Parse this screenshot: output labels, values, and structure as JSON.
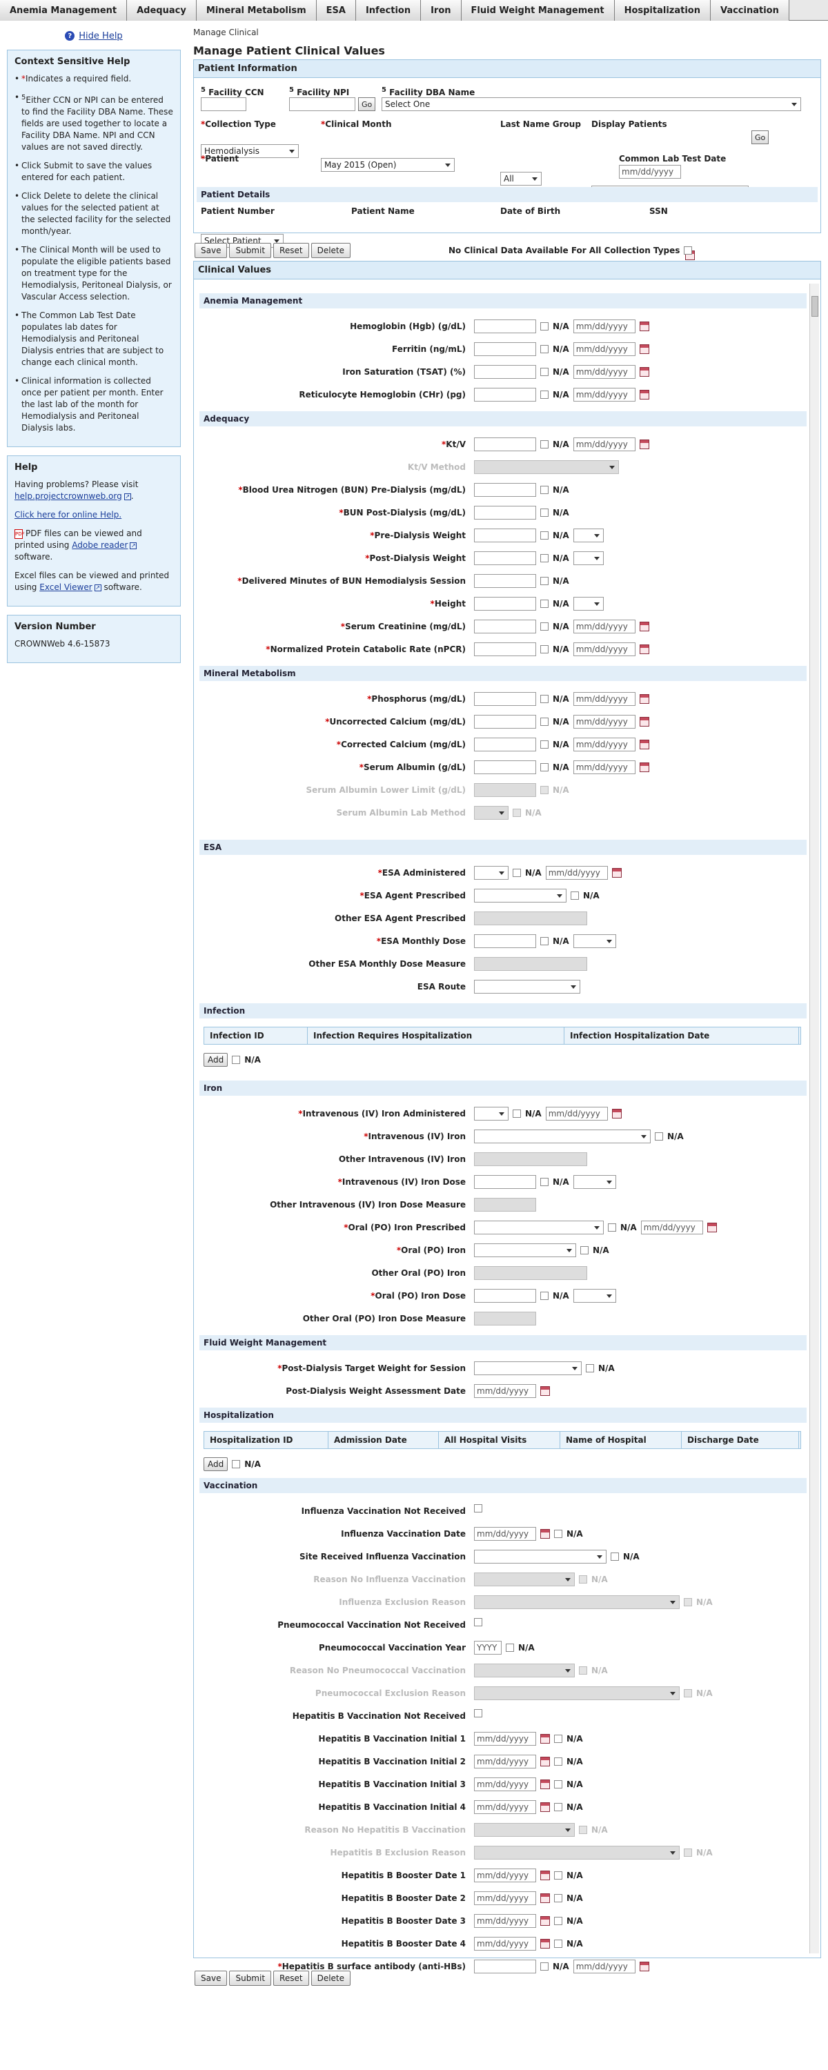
{
  "tabs": [
    "Anemia Management",
    "Adequacy",
    "Mineral Metabolism",
    "ESA",
    "Infection",
    "Iron",
    "Fluid Weight Management",
    "Hospitalization",
    "Vaccination"
  ],
  "help": {
    "hide": "Hide Help",
    "context_title": "Context Sensitive Help",
    "items": [
      "Indicates a required field.",
      "Either CCN or NPI can be entered to find the Facility DBA Name. These fields are used together to locate a Facility DBA Name. NPI and CCN values are not saved directly.",
      "Click Submit to save the values entered for each patient.",
      "Click Delete to delete the clinical values for the selected patient at the selected facility for the selected month/year.",
      "The Clinical Month will be used to populate the eligible patients based on treatment type for the Hemodialysis, Peritoneal Dialysis, or Vascular Access selection.",
      "The Common Lab Test Date populates lab dates for Hemodialysis and Peritoneal Dialysis entries that are subject to change each clinical month.",
      "Clinical information is collected once per patient per month. Enter the last lab of the month for Hemodialysis and Peritoneal Dialysis labs."
    ],
    "help_title": "Help",
    "problems": "Having problems? Please visit",
    "help_link": "help.projectcrownweb.org",
    "online": "Click here for online Help.",
    "pdf_text": "PDF files can be viewed and printed using",
    "pdf_link": "Adobe reader",
    "excel_text": "Excel files can be viewed and printed using",
    "excel_link": "Excel Viewer",
    "software": "software.",
    "version_title": "Version Number",
    "version": "CROWNWeb 4.6-15873"
  },
  "main": {
    "crumb": "Manage Clinical",
    "title": "Manage Patient Clinical Values",
    "patient_info": "Patient Information",
    "fac_ccn": "Facility CCN",
    "fac_npi": "Facility NPI",
    "fac_dba": "Facility DBA Name",
    "dba_value": "Select One",
    "go": "Go",
    "coll_type": "Collection Type",
    "coll_value": "Hemodialysis",
    "month": "Clinical Month",
    "month_value": "May 2015 (Open)",
    "lastname": "Last Name Group",
    "lastname_value": "All",
    "display": "Display Patients",
    "patient": "Patient",
    "patient_value": "Select Patient",
    "common_date": "Common Lab Test Date",
    "date_ph": "mm/dd/yyyy",
    "details": "Patient Details",
    "details_cols": [
      "Patient Number",
      "Patient Name",
      "Date of Birth",
      "SSN"
    ],
    "save": "Save",
    "submit": "Submit",
    "reset": "Reset",
    "delete": "Delete",
    "no_data": "No Clinical Data Available For All Collection Types",
    "clinical": "Clinical Values",
    "na": "N/A",
    "yyyy": "YYYY",
    "add": "Add"
  },
  "sections": {
    "anemia": "Anemia Management",
    "adequacy": "Adequacy",
    "mineral": "Mineral Metabolism",
    "esa": "ESA",
    "infection": "Infection",
    "iron": "Iron",
    "fluid": "Fluid Weight Management",
    "hosp": "Hospitalization",
    "vacc": "Vaccination"
  },
  "labels": {
    "hgb": "Hemoglobin (Hgb) (g/dL)",
    "ferritin": "Ferritin (ng/mL)",
    "tsat": "Iron Saturation (TSAT) (%)",
    "chr": "Reticulocyte Hemoglobin (CHr) (pg)",
    "ktv": "Kt/V",
    "ktv_method": "Kt/V Method",
    "bun_pre": "Blood Urea Nitrogen (BUN) Pre-Dialysis (mg/dL)",
    "bun_post": "BUN Post-Dialysis (mg/dL)",
    "pre_wt": "Pre-Dialysis Weight",
    "post_wt": "Post-Dialysis Weight",
    "delivered": "Delivered Minutes of BUN Hemodialysis Session",
    "height": "Height",
    "creat": "Serum Creatinine (mg/dL)",
    "npcr": "Normalized Protein Catabolic Rate (nPCR)",
    "phos": "Phosphorus (mg/dL)",
    "uncorr": "Uncorrected Calcium (mg/dL)",
    "corr": "Corrected Calcium (mg/dL)",
    "albumin": "Serum Albumin (g/dL)",
    "alb_lower": "Serum Albumin Lower Limit (g/dL)",
    "alb_method": "Serum Albumin Lab Method",
    "esa_admin": "ESA Administered",
    "esa_agent": "ESA Agent Prescribed",
    "esa_other": "Other ESA Agent Prescribed",
    "esa_dose": "ESA Monthly Dose",
    "esa_other_dose": "Other ESA Monthly Dose Measure",
    "esa_route": "ESA Route",
    "inf_cols": [
      "Infection ID",
      "Infection Requires Hospitalization",
      "Infection Hospitalization Date"
    ],
    "iv_admin": "Intravenous (IV) Iron Administered",
    "iv_iron": "Intravenous (IV) Iron",
    "iv_other": "Other Intravenous (IV) Iron",
    "iv_dose": "Intravenous (IV) Iron Dose",
    "iv_other_dose": "Other Intravenous (IV) Iron Dose Measure",
    "po_pres": "Oral (PO) Iron Prescribed",
    "po_iron": "Oral (PO) Iron",
    "po_other": "Other Oral (PO) Iron",
    "po_dose": "Oral (PO) Iron Dose",
    "po_other_dose": "Other Oral (PO) Iron Dose Measure",
    "target_wt": "Post-Dialysis Target Weight for Session",
    "assess_date": "Post-Dialysis Weight Assessment Date",
    "hosp_cols": [
      "Hospitalization ID",
      "Admission Date",
      "All Hospital Visits",
      "Name of Hospital",
      "Discharge Date"
    ],
    "flu_not": "Influenza Vaccination Not Received",
    "flu_date": "Influenza Vaccination Date",
    "flu_site": "Site Received Influenza Vaccination",
    "flu_reason": "Reason No Influenza Vaccination",
    "flu_excl": "Influenza Exclusion Reason",
    "pn_not": "Pneumococcal Vaccination Not Received",
    "pn_year": "Pneumococcal Vaccination Year",
    "pn_reason": "Reason No Pneumococcal Vaccination",
    "pn_excl": "Pneumococcal Exclusion Reason",
    "hb_not": "Hepatitis B Vaccination Not Received",
    "hb1": "Hepatitis B Vaccination Initial 1",
    "hb2": "Hepatitis B Vaccination Initial 2",
    "hb3": "Hepatitis B Vaccination Initial 3",
    "hb4": "Hepatitis B Vaccination Initial 4",
    "hb_reason": "Reason No Hepatitis B Vaccination",
    "hb_excl": "Hepatitis B Exclusion Reason",
    "hbb1": "Hepatitis B Booster Date 1",
    "hbb2": "Hepatitis B Booster Date 2",
    "hbb3": "Hepatitis B Booster Date 3",
    "hbb4": "Hepatitis B Booster Date 4",
    "hbs": "Hepatitis B surface antibody (anti-HBs)"
  }
}
